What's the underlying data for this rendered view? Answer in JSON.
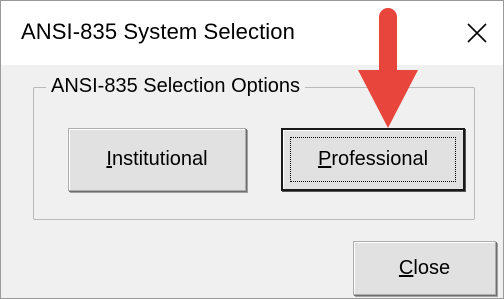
{
  "window": {
    "title": "ANSI-835 System Selection",
    "close_icon": "close-x-icon"
  },
  "group": {
    "legend": "ANSI-835 Selection Options"
  },
  "buttons": {
    "institutional": {
      "mnemonic": "I",
      "rest": "nstitutional"
    },
    "professional": {
      "mnemonic": "P",
      "rest": "rofessional"
    },
    "close": {
      "mnemonic": "C",
      "rest": "lose"
    }
  },
  "annotation": {
    "arrow_icon": "down-arrow-annotation-icon",
    "arrow_color": "#e8453c"
  },
  "colors": {
    "titlebar_bg": "#ffffff",
    "dialog_bg": "#f0f0f0",
    "button_bg": "#e1e1e1",
    "button_border": "#adadad",
    "focused_border": "#1a1a1a"
  }
}
